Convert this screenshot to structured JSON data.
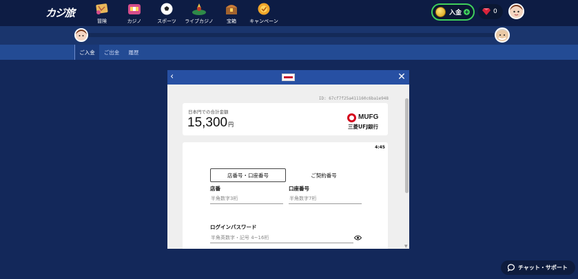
{
  "brand": {
    "logo_text": "カジ旅"
  },
  "nav": [
    {
      "label": "冒険",
      "icon": "adventure-map-icon"
    },
    {
      "label": "カジノ",
      "icon": "slot-machine-icon"
    },
    {
      "label": "スポーツ",
      "icon": "soccer-ball-icon"
    },
    {
      "label": "ライブカジノ",
      "icon": "roulette-icon"
    },
    {
      "label": "宝箱",
      "icon": "treasure-chest-icon"
    },
    {
      "label": "キャンペーン",
      "icon": "campaign-badge-icon"
    }
  ],
  "header_right": {
    "deposit_label": "入金",
    "gem_count": "0"
  },
  "tabs": [
    {
      "label": "ご入金",
      "active": true
    },
    {
      "label": "ご出金",
      "active": false
    },
    {
      "label": "履歴",
      "active": false
    }
  ],
  "modal": {
    "order_id": "ID: 67cf7f25a411160c6ba1e948",
    "amount_caption": "日本円での合計金額",
    "amount_value": "15,300",
    "amount_unit": "円",
    "bank": {
      "name_en": "MUFG",
      "name_jp": "三菱UFJ銀行",
      "brand_color": "#d4001a"
    },
    "timer": "4:45",
    "segments": [
      "店番号・口座番号",
      "ご契約番号"
    ],
    "fields": {
      "branch_label": "店番",
      "branch_placeholder": "半角数字3桁",
      "account_label": "口座番号",
      "account_placeholder": "半角数字7桁",
      "password_label": "ログインパスワード",
      "password_placeholder": "半角英数字・記号 4~16桁"
    }
  },
  "chat": {
    "label": "チャット・サポート"
  },
  "colors": {
    "page_bg": "#13285a",
    "tab_bar": "#234b94",
    "modal_header": "#2750a3",
    "deposit_border": "#3fcf5b"
  }
}
